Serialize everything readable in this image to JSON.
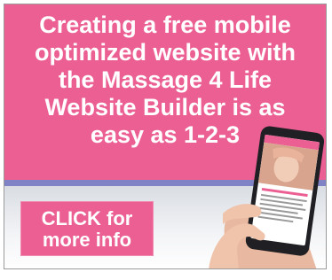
{
  "ad": {
    "headline_lines": [
      "Creating a free mobile",
      "optimized website with",
      "the Massage 4 Life",
      "Website Builder is as",
      "easy as 1-2-3"
    ],
    "cta_lines": [
      "CLICK for",
      "more info"
    ]
  },
  "colors": {
    "brand_pink": "#ec5f93",
    "stripe_blue": "#7f82c4",
    "text_white": "#ffffff"
  },
  "icons": [
    "phone-illustration",
    "hand-illustration"
  ]
}
